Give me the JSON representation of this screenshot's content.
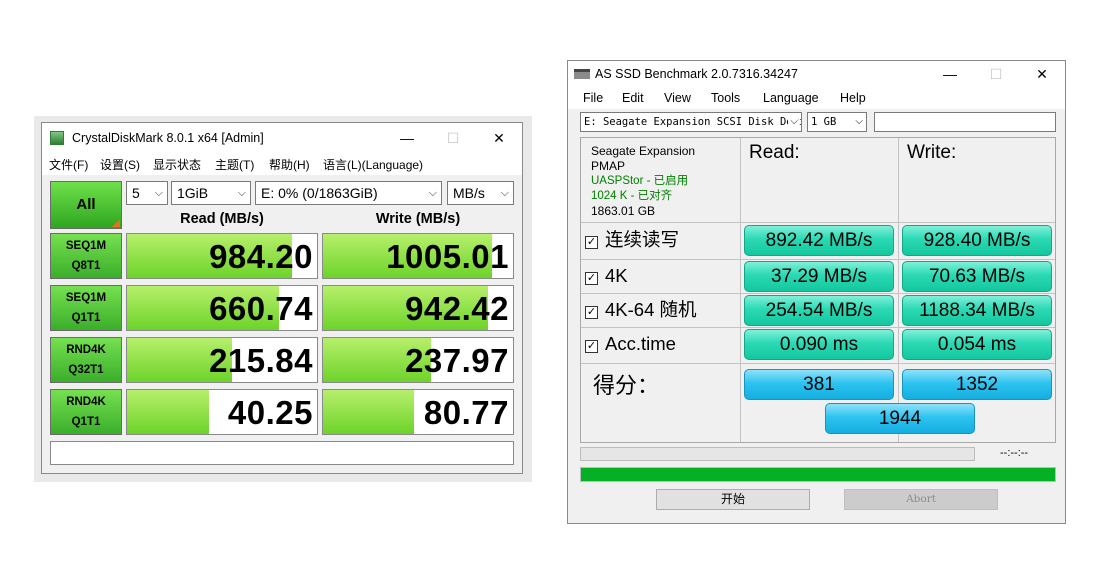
{
  "cdm": {
    "title": "CrystalDiskMark 8.0.1 x64 [Admin]",
    "menu": [
      "文件(F)",
      "设置(S)",
      "显示状态",
      "主题(T)",
      "帮助(H)",
      "语言(L)(Language)"
    ],
    "all_button": "All",
    "count": "5",
    "size": "1GiB",
    "drive": "E: 0% (0/1863GiB)",
    "unit": "MB/s",
    "read_header": "Read (MB/s)",
    "write_header": "Write (MB/s)",
    "rows": [
      {
        "line1": "SEQ1M",
        "line2": "Q8T1",
        "read": "984.20",
        "write": "1005.01",
        "read_fill": 0.87,
        "write_fill": 0.89
      },
      {
        "line1": "SEQ1M",
        "line2": "Q1T1",
        "read": "660.74",
        "write": "942.42",
        "read_fill": 0.8,
        "write_fill": 0.87
      },
      {
        "line1": "RND4K",
        "line2": "Q32T1",
        "read": "215.84",
        "write": "237.97",
        "read_fill": 0.55,
        "write_fill": 0.57
      },
      {
        "line1": "RND4K",
        "line2": "Q1T1",
        "read": "40.25",
        "write": "80.77",
        "read_fill": 0.43,
        "write_fill": 0.48
      }
    ],
    "window_buttons": {
      "minimize": "—",
      "maximize": "☐",
      "close": "✕"
    }
  },
  "asssd": {
    "title": "AS SSD Benchmark 2.0.7316.34247",
    "menu": [
      "File",
      "Edit",
      "View",
      "Tools",
      "Language",
      "Help"
    ],
    "disk_select": "E: Seagate Expansion SCSI Disk Device",
    "size_select": "1 GB",
    "info": {
      "model": "Seagate Expansion",
      "fw": "PMAP",
      "driver": "UASPStor - 已启用",
      "align": "1024 K - 已对齐",
      "capacity": "1863.01 GB"
    },
    "read_header": "Read:",
    "write_header": "Write:",
    "rows": [
      {
        "label": "连续读写",
        "read": "892.42 MB/s",
        "write": "928.40 MB/s"
      },
      {
        "label": "4K",
        "read": "37.29 MB/s",
        "write": "70.63 MB/s"
      },
      {
        "label": "4K-64 随机",
        "read": "254.54 MB/s",
        "write": "1188.34 MB/s"
      },
      {
        "label": "Acc.time",
        "read": "0.090 ms",
        "write": "0.054 ms"
      }
    ],
    "checkmark": "☑",
    "score_label": "得分：",
    "score_read": "381",
    "score_write": "1352",
    "score_total": "1944",
    "time": "--:--:--",
    "progress": 1.0,
    "start_button": "开始",
    "abort_button": "Abort",
    "window_buttons": {
      "minimize": "—",
      "maximize": "☐",
      "close": "✕"
    }
  },
  "colors": {
    "cdm_bar": "#6dd32a",
    "as_result": "#2bd9b4",
    "as_score": "#2ec3f0",
    "progress": "#06b025",
    "uasp_text": "#008000"
  }
}
